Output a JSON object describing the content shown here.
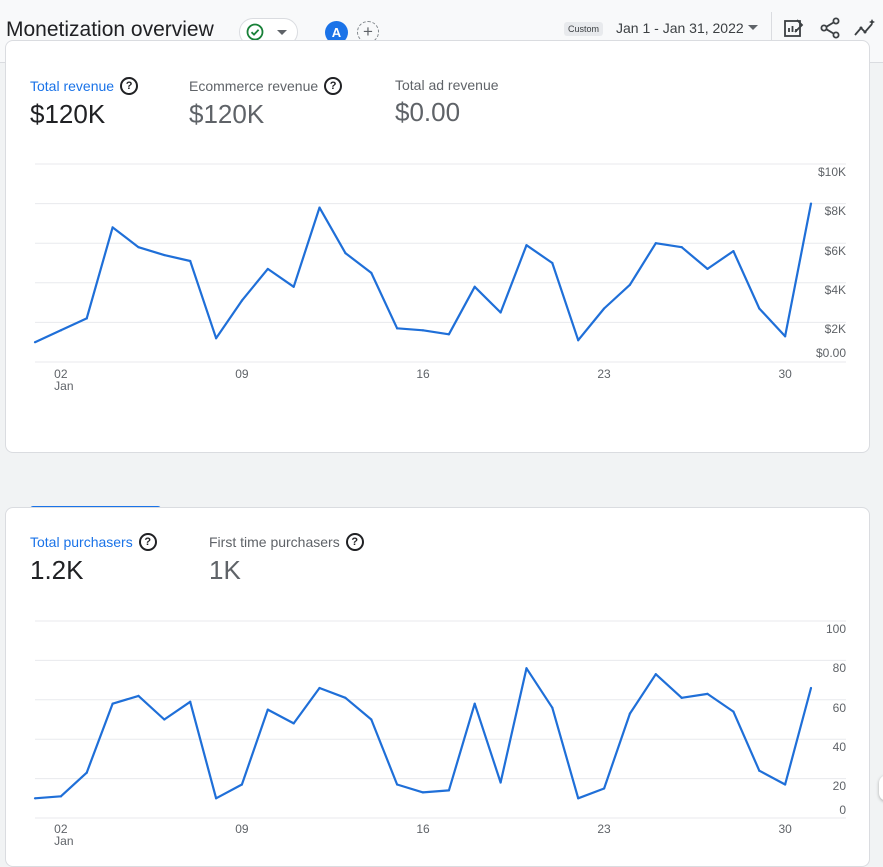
{
  "header": {
    "title": "Monetization overview",
    "avatar_letter": "A",
    "add_label": "+",
    "custom_label": "Custom",
    "date_range": "Jan 1 - Jan 31, 2022"
  },
  "colors": {
    "accent": "#1a73e8",
    "line": "#1f6fd8",
    "grid": "#e8eaed",
    "axis_text": "#5f6368"
  },
  "card1": {
    "metrics": [
      {
        "label": "Total revenue",
        "value": "$120K",
        "active": true
      },
      {
        "label": "Ecommerce revenue",
        "value": "$120K",
        "active": false
      },
      {
        "label": "Total ad revenue",
        "value": "$0.00",
        "active": false
      }
    ]
  },
  "card2": {
    "metrics": [
      {
        "label": "Total purchasers",
        "value": "1.2K",
        "active": true
      },
      {
        "label": "First time purchasers",
        "value": "1K",
        "active": false
      }
    ]
  },
  "chart_data": [
    {
      "type": "line",
      "y_ticks": [
        "$10K",
        "$8K",
        "$6K",
        "$4K",
        "$2K",
        "$0.00"
      ],
      "ylim": [
        0,
        10000
      ],
      "x_ticks": [
        {
          "day": 2,
          "label": "02",
          "sublabel": "Jan"
        },
        {
          "day": 9,
          "label": "09"
        },
        {
          "day": 16,
          "label": "16"
        },
        {
          "day": 23,
          "label": "23"
        },
        {
          "day": 30,
          "label": "30"
        }
      ],
      "x": [
        1,
        2,
        3,
        4,
        5,
        6,
        7,
        8,
        9,
        10,
        11,
        12,
        13,
        14,
        15,
        16,
        17,
        18,
        19,
        20,
        21,
        22,
        23,
        24,
        25,
        26,
        27,
        28,
        29,
        30,
        31
      ],
      "values": [
        1000,
        1600,
        2200,
        6800,
        5800,
        5400,
        5100,
        1200,
        3100,
        4700,
        3800,
        7800,
        5500,
        4500,
        1700,
        1600,
        1400,
        3800,
        2500,
        5900,
        5000,
        1100,
        2700,
        3900,
        6000,
        5800,
        4700,
        5600,
        2700,
        1300,
        8000
      ],
      "grid": true
    },
    {
      "type": "line",
      "y_ticks": [
        "100",
        "80",
        "60",
        "40",
        "20",
        "0"
      ],
      "ylim": [
        0,
        100
      ],
      "x_ticks": [
        {
          "day": 2,
          "label": "02",
          "sublabel": "Jan"
        },
        {
          "day": 9,
          "label": "09"
        },
        {
          "day": 16,
          "label": "16"
        },
        {
          "day": 23,
          "label": "23"
        },
        {
          "day": 30,
          "label": "30"
        }
      ],
      "x": [
        1,
        2,
        3,
        4,
        5,
        6,
        7,
        8,
        9,
        10,
        11,
        12,
        13,
        14,
        15,
        16,
        17,
        18,
        19,
        20,
        21,
        22,
        23,
        24,
        25,
        26,
        27,
        28,
        29,
        30,
        31
      ],
      "values": [
        10,
        11,
        23,
        58,
        62,
        50,
        59,
        10,
        17,
        55,
        48,
        66,
        61,
        50,
        17,
        13,
        14,
        58,
        18,
        76,
        56,
        10,
        15,
        53,
        73,
        61,
        63,
        54,
        24,
        17,
        66
      ],
      "grid": true
    }
  ]
}
